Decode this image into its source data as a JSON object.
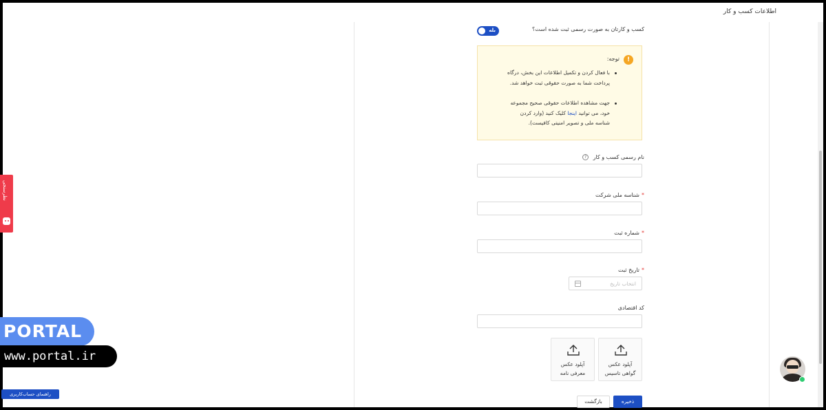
{
  "header": {
    "title": "اطلاعات کسب و کار"
  },
  "registration": {
    "question": "کسب و کارتان به صورت رسمی ثبت شده است؟",
    "toggle_label": "بله",
    "toggle_on": true
  },
  "notice": {
    "title": "توجه:",
    "bullets": [
      {
        "line1": "با فعال کردن و تکمیل اطلاعات این بخش، درگاه",
        "line2": "پرداخت شما به صورت حقوقی ثبت خواهد شد."
      },
      {
        "line1": "جهت مشاهده اطلاعات حقوقی صحیح مجموعه",
        "line2_before": "خود، می توانید",
        "line2_link": "اینجا",
        "line2_after": "کلیک کنید (وارد کردن",
        "line3": "شناسه ملی و تصویر امنیتی کافیست)."
      }
    ]
  },
  "form": {
    "official_name": {
      "label": "نام رسمی کسب و کار",
      "help": "?",
      "value": ""
    },
    "national_id": {
      "label": "شناسه ملی شرکت",
      "required": "*",
      "value": ""
    },
    "registration_number": {
      "label": "شماره ثبت",
      "required": "*",
      "value": ""
    },
    "registration_date": {
      "label": "تاریخ ثبت",
      "required": "*",
      "placeholder": "انتخاب تاریخ"
    },
    "economic_code": {
      "label": "کد اقتصادی",
      "value": ""
    }
  },
  "uploads": [
    {
      "line1": "آپلود عکس",
      "line2": "گواهی تاسیس"
    },
    {
      "line1": "آپلود عکس",
      "line2": "معرفی نامه"
    }
  ],
  "actions": {
    "save": "ذخیره",
    "back": "بازگشت"
  },
  "feedback": {
    "label": "نظرسنجی"
  },
  "watermark": {
    "brand": "PORTAL",
    "url": "www.portal.ir"
  },
  "guide": {
    "label": "راهنمای حساب‌کاربری"
  },
  "colors": {
    "primary": "#1d4fc4",
    "notice_bg": "#fffbe6",
    "warning": "#f5a623",
    "feedback": "#ef3b4a",
    "online": "#2ecc71"
  }
}
